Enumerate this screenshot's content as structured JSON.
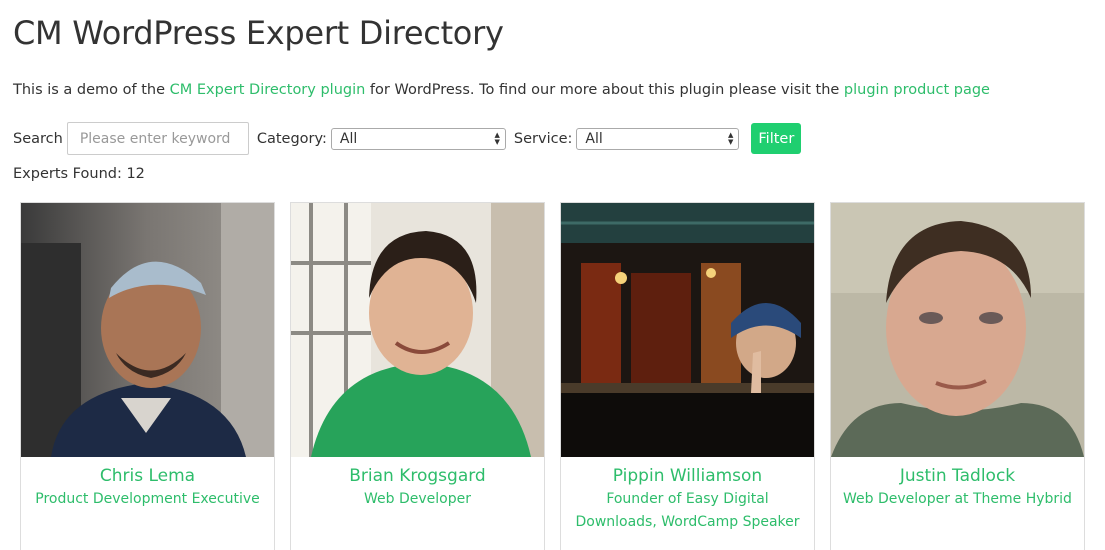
{
  "page": {
    "title": "CM WordPress Expert Directory",
    "intro_prefix": "This is a demo of the ",
    "intro_link1": "CM Expert Directory plugin",
    "intro_middle": " for WordPress. To find our more about this plugin please visit the ",
    "intro_link2": "plugin product page"
  },
  "filters": {
    "search_label": "Search",
    "search_placeholder": "Please enter keyword",
    "category_label": "Category:",
    "category_value": "All",
    "service_label": "Service:",
    "service_value": "All",
    "filter_button": "Filter"
  },
  "results": {
    "found_text": "Experts Found: 12"
  },
  "experts": [
    {
      "name": "Chris Lema",
      "role": "Product Development Executive"
    },
    {
      "name": "Brian Krogsgard",
      "role": "Web Developer"
    },
    {
      "name": "Pippin Williamson",
      "role": "Founder of Easy Digital Downloads, WordCamp Speaker"
    },
    {
      "name": "Justin Tadlock",
      "role": "Web Developer at Theme Hybrid"
    }
  ],
  "colors": {
    "accent_green": "#2ebd6b",
    "button_green": "#1fcf70"
  }
}
